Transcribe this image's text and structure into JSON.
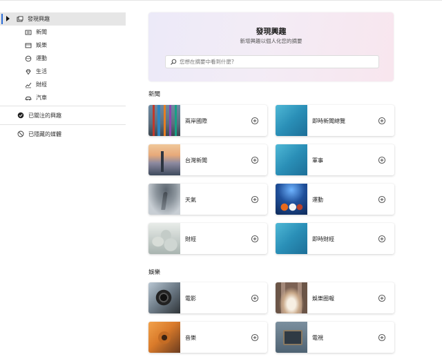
{
  "sidebar": {
    "header_label": "發現興趣",
    "sub_items": [
      {
        "label": "新聞",
        "icon": "newspaper-icon"
      },
      {
        "label": "娛樂",
        "icon": "film-icon"
      },
      {
        "label": "運動",
        "icon": "ball-icon"
      },
      {
        "label": "生活",
        "icon": "diamond-icon"
      },
      {
        "label": "財經",
        "icon": "chart-icon"
      },
      {
        "label": "汽車",
        "icon": "car-icon"
      }
    ],
    "followed_label": "已關注的興趣",
    "blocked_label": "已隱藏的媒體"
  },
  "hero": {
    "title": "發現興趣",
    "subtitle": "新增興趣以個人化您的摘要",
    "search_placeholder": "您想在摘要中看到什麼?"
  },
  "sections": [
    {
      "title": "新聞",
      "cards": [
        {
          "label": "兩岸國際",
          "thumb": "flags"
        },
        {
          "label": "即時新聞總覽",
          "thumb": "blue"
        },
        {
          "label": "台灣新聞",
          "thumb": "city"
        },
        {
          "label": "軍事",
          "thumb": "blue"
        },
        {
          "label": "天氣",
          "thumb": "storm"
        },
        {
          "label": "運動",
          "thumb": "sports"
        },
        {
          "label": "財經",
          "thumb": "coins"
        },
        {
          "label": "即時財經",
          "thumb": "blue"
        }
      ]
    },
    {
      "title": "娛樂",
      "cards": [
        {
          "label": "電影",
          "thumb": "camera"
        },
        {
          "label": "娛樂圈報",
          "thumb": "theater"
        },
        {
          "label": "音樂",
          "thumb": "guitar"
        },
        {
          "label": "電視",
          "thumb": "tv"
        }
      ]
    }
  ],
  "colors": {
    "accent_bar": "#2b6cd6",
    "sidebar_selected_bg": "#e6e6e6",
    "hero_gradient_start": "#eceaf8",
    "hero_gradient_end": "#f8e6ee"
  }
}
